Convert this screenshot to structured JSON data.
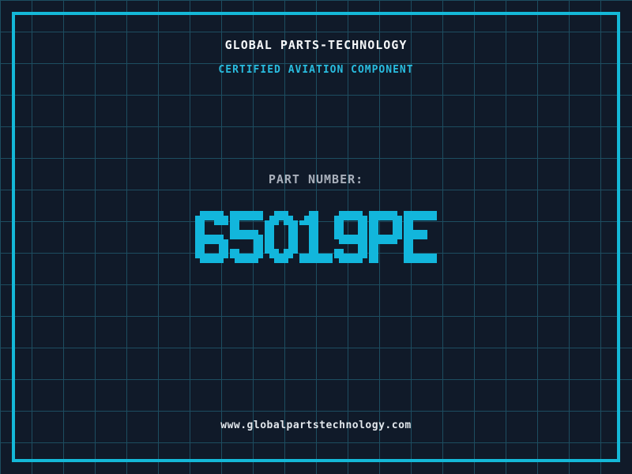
{
  "header": {
    "title": "GLOBAL PARTS-TECHNOLOGY",
    "subtitle": "CERTIFIED AVIATION COMPONENT"
  },
  "part_number": {
    "label": "PART NUMBER:",
    "value": "65O19PE"
  },
  "footer": {
    "url": "www.globalpartstechnology.com"
  },
  "colors": {
    "background": "#101a29",
    "grid_line": "#1d4d60",
    "frame": "#14b8d8",
    "title": "#f5f7f9",
    "subtitle": "#29bcdf",
    "label": "#a9b0bb",
    "part_number": "#12b6dc",
    "url": "#e2e7ec"
  }
}
